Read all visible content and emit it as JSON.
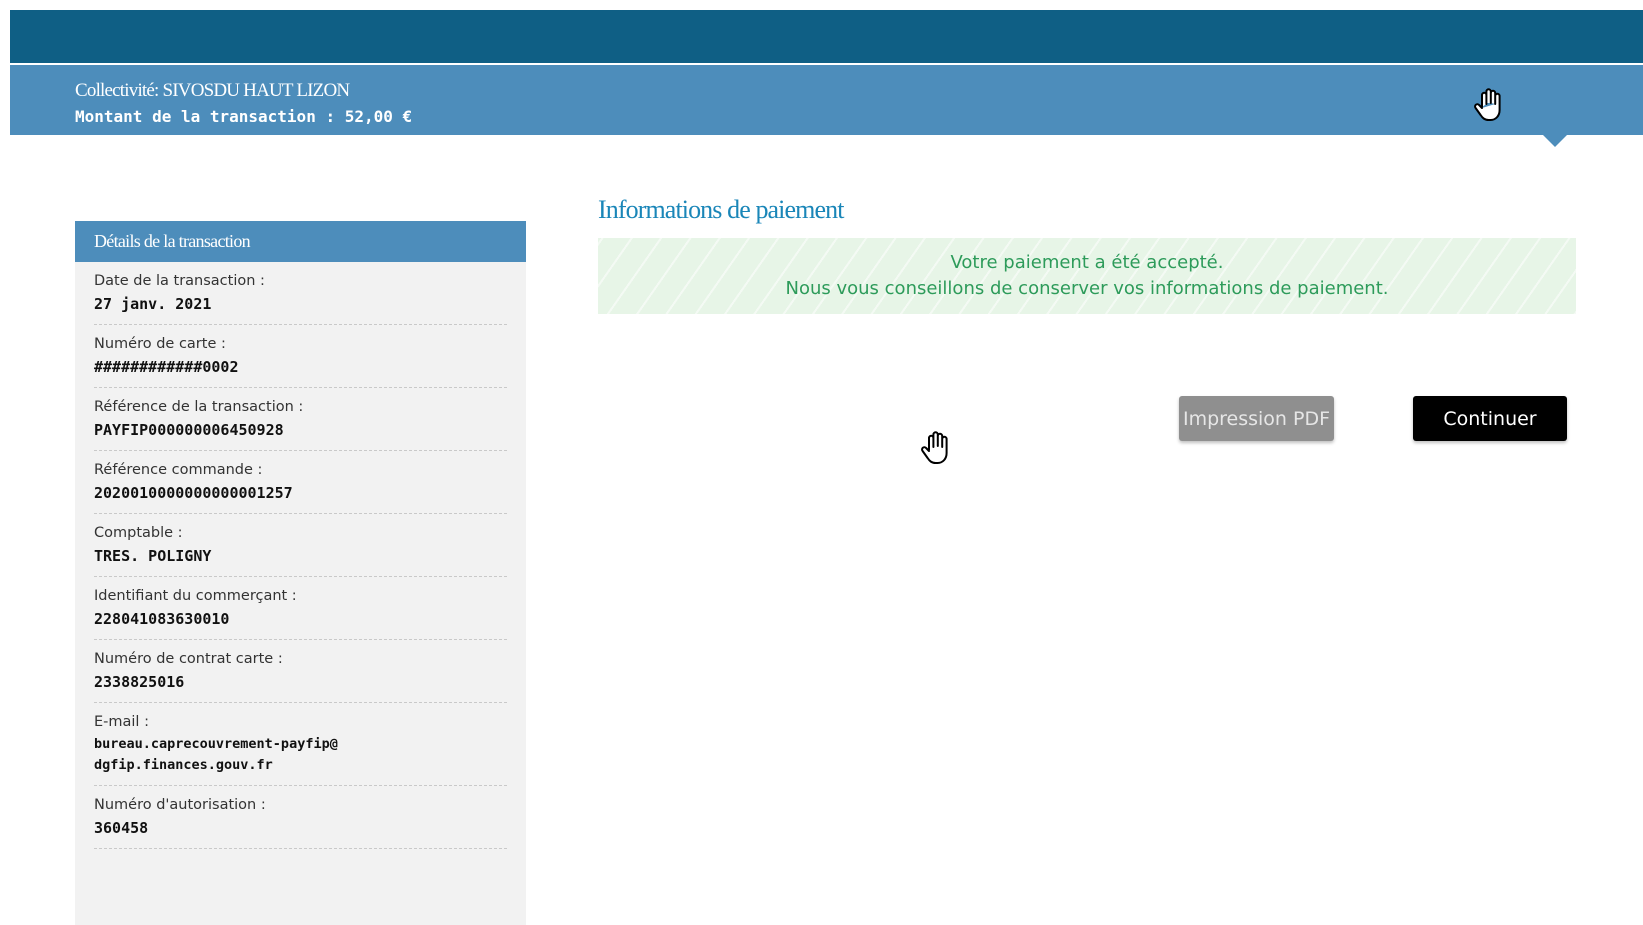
{
  "header": {
    "collectivite": "Collectivité: SIVOSDU HAUT LIZON",
    "montant": "Montant de la transaction :  52,00 €"
  },
  "sidebar": {
    "title": "Détails de la transaction",
    "details": [
      {
        "label": "Date de la transaction :",
        "value": "27 janv. 2021"
      },
      {
        "label": "Numéro de carte :",
        "value": "############0002"
      },
      {
        "label": "Référence de la transaction :",
        "value": "PAYFIP000000006450928"
      },
      {
        "label": "Référence commande :",
        "value": "2020010000000000001257"
      },
      {
        "label": "Comptable :",
        "value": "TRES. POLIGNY"
      },
      {
        "label": "Identifiant du commerçant :",
        "value": "228041083630010"
      },
      {
        "label": "Numéro de contrat carte :",
        "value": "2338825016"
      },
      {
        "label": "E-mail :",
        "value": "bureau.caprecouvrement-payfip@dgfip.finances.gouv.fr"
      },
      {
        "label": "Numéro d'autorisation :",
        "value": "360458"
      }
    ]
  },
  "main": {
    "title": "Informations de paiement",
    "success_line1": "Votre paiement a été accepté.",
    "success_line2": "Nous vous conseillons de conserver vos informations de paiement.",
    "pdf_button": "Impression PDF",
    "continue_button": "Continuer"
  },
  "icons": {
    "cursor": "hand-pointer-icon"
  },
  "colors": {
    "topbar": "#0f5f85",
    "subbar": "#4d8dbb",
    "title": "#1a86b8",
    "success_text": "#2d9b5a",
    "success_bg": "#e7f5e7"
  }
}
